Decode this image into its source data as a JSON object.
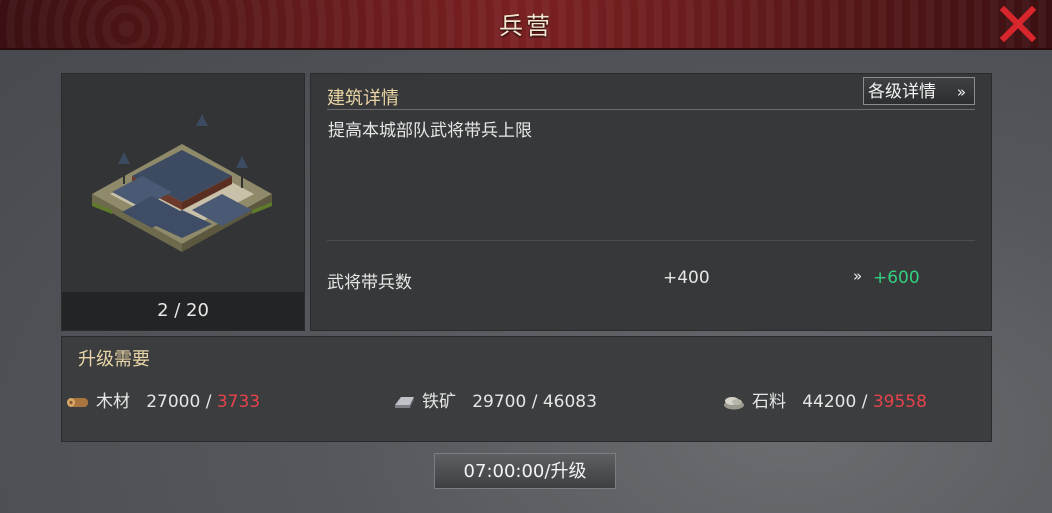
{
  "title": "兵营",
  "building": {
    "level": "2 / 20",
    "icon": "barracks-building-image"
  },
  "details": {
    "section_title": "建筑详情",
    "all_levels_button": "各级详情",
    "all_levels_chevron": "»",
    "description": "提高本城部队武将带兵上限",
    "stat": {
      "label": "武将带兵数",
      "current": "+400",
      "arrow": "»",
      "next": "+600"
    }
  },
  "requirements": {
    "section_title": "升级需要",
    "items": [
      {
        "icon": "wood-icon",
        "name": "木材",
        "required": "27000",
        "separator": " / ",
        "owned": "3733",
        "insufficient": true
      },
      {
        "icon": "iron-ore-icon",
        "name": "铁矿",
        "required": "29700",
        "separator": " / ",
        "owned": "46083",
        "insufficient": false
      },
      {
        "icon": "stone-icon",
        "name": "石料",
        "required": "44200",
        "separator": " / ",
        "owned": "39558",
        "insufficient": true
      }
    ]
  },
  "upgrade_button": "07:00:00/升级",
  "colors": {
    "title_bar": "#6b1c1d",
    "gold_text": "#e9d4a6",
    "insufficient": "#e8424a",
    "bonus": "#35d07f",
    "close_icon": "#d9262c"
  }
}
